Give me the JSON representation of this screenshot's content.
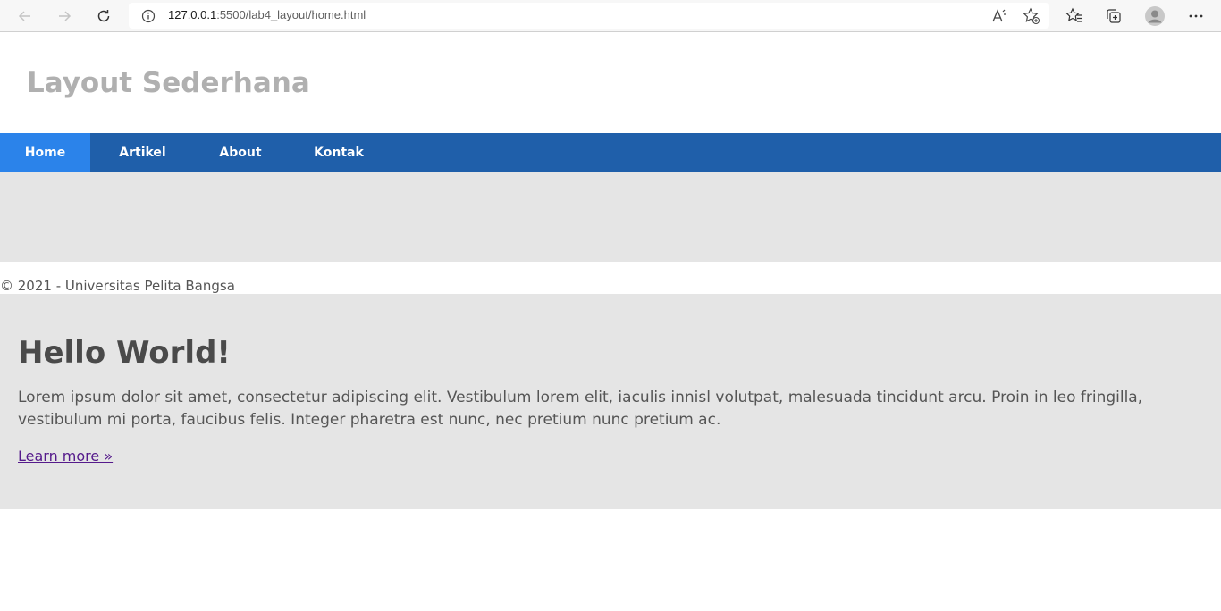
{
  "browser": {
    "url_host": "127.0.0.1",
    "url_path": ":5500/lab4_layout/home.html",
    "icons": [
      "back-icon",
      "forward-icon",
      "refresh-icon",
      "info-icon",
      "read-aloud-icon",
      "add-favorite-icon",
      "favorites-icon",
      "collections-icon",
      "profile-icon",
      "more-icon"
    ]
  },
  "site": {
    "title": "Layout Sederhana",
    "nav": [
      {
        "label": "Home",
        "active": true
      },
      {
        "label": "Artikel",
        "active": false
      },
      {
        "label": "About",
        "active": false
      },
      {
        "label": "Kontak",
        "active": false
      }
    ],
    "footer": "© 2021 - Universitas Pelita Bangsa",
    "hero": {
      "title": "Hello World!",
      "text": "Lorem ipsum dolor sit amet, consectetur adipiscing elit. Vestibulum lorem elit, iaculis innisl volutpat, malesuada tincidunt arcu. Proin in leo fringilla, vestibulum mi porta, faucibus felis. Integer pharetra est nunc, nec pretium nunc pretium ac.",
      "link": "Learn more »"
    }
  },
  "colors": {
    "nav_bg": "#1f5faa",
    "nav_active": "#2b83ea",
    "banner_bg": "#e5e5e5",
    "title": "#b0b0b0",
    "link": "#551a8b"
  }
}
